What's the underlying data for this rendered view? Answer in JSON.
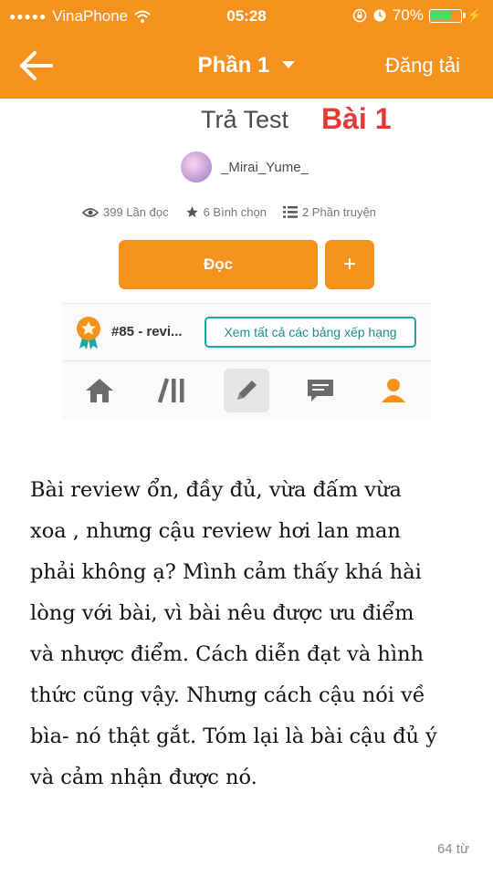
{
  "status_bar": {
    "carrier": "VinaPhone",
    "time": "05:28",
    "battery": "70%",
    "battery_level": 0.7
  },
  "nav": {
    "title": "Phần 1",
    "upload_label": "Đăng tải"
  },
  "story_card": {
    "title": "Trả Test",
    "tag": "Bài 1",
    "author": "_Mirai_Yume_",
    "stats": {
      "reads": "399 Lần đọc",
      "votes": "6 Bình chọn",
      "parts": "2 Phần truyện"
    },
    "read_button": "Đọc",
    "add_button": "+",
    "rank": "#85 - revi...",
    "rank_button": "Xem tất cả các bảng xếp hạng"
  },
  "review_lines": [
    "Bài review ổn, đầy đủ, vừa đấm vừa",
    "xoa , nhưng cậu review hơi lan man",
    "phải không ạ? Mình cảm thấy khá hài",
    "lòng với bài, vì bài nêu được ưu điểm",
    "và nhược điểm. Cách diễn đạt và hình",
    "thức cũng vậy. Nhưng cách cậu nói về",
    "bìa- nó thật gắt. Tóm lại là bài cậu đủ ý",
    "và cảm nhận được nó."
  ],
  "word_count": "64 từ",
  "colors": {
    "accent": "#f5921e",
    "teal": "#1ba9a3",
    "title_red": "#e53935"
  }
}
